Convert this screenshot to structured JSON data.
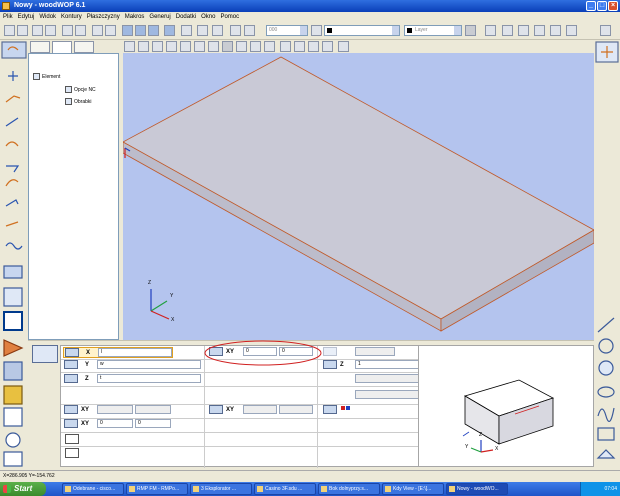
{
  "window": {
    "title": "Nowy - woodWOP 6.1"
  },
  "menu": [
    "Plik",
    "Edytuj",
    "Widok",
    "Kontury",
    "Płaszczyzny",
    "Makros",
    "Generuj",
    "Dodatki",
    "Okno",
    "Pomoc"
  ],
  "toolbar": {
    "combo1_value": "000",
    "combo2_value": "",
    "layer_placeholder": "Layer"
  },
  "tree": {
    "root": "Element",
    "children": [
      "Opcje NC",
      "Obrabki"
    ]
  },
  "props": {
    "x_label": "X",
    "x_value": "l",
    "y_label": "Y",
    "y_value": "w",
    "z_label": "Z",
    "z_value": "t",
    "xy_label": "XY",
    "xy_a": "0",
    "xy_b": "0",
    "z2_label": "Z",
    "z2_value": "1",
    "xy2_label": "XY",
    "xy2_a": "0",
    "xy2_b": "0",
    "xy3_label": "XY",
    "xy3_a": "0",
    "xy3_b": "0"
  },
  "preview_axes": {
    "x": "X",
    "y": "Y",
    "z": "Z"
  },
  "viewport_axes": {
    "x": "X",
    "y": "Y",
    "z": "Z"
  },
  "statusbar": {
    "coords": "X=286.905 Y=-154.762"
  },
  "taskbar": {
    "start": "Start",
    "tasks": [
      "Odebrane - cisco...",
      "RMP FM - RMPo...",
      "3 Eksplorator ...",
      "Casino 3F.sdu ...",
      "Bok dolnyprzy.s...",
      "Kdy View - [E:\\]...",
      "Nowy - woodWO..."
    ],
    "clock": "07:04"
  },
  "colors": {
    "viewport_bg": "#b4c4ee",
    "panel_top": "#c9c9d6",
    "panel_edge": "#c05a2a",
    "annotation": "#d02020"
  }
}
